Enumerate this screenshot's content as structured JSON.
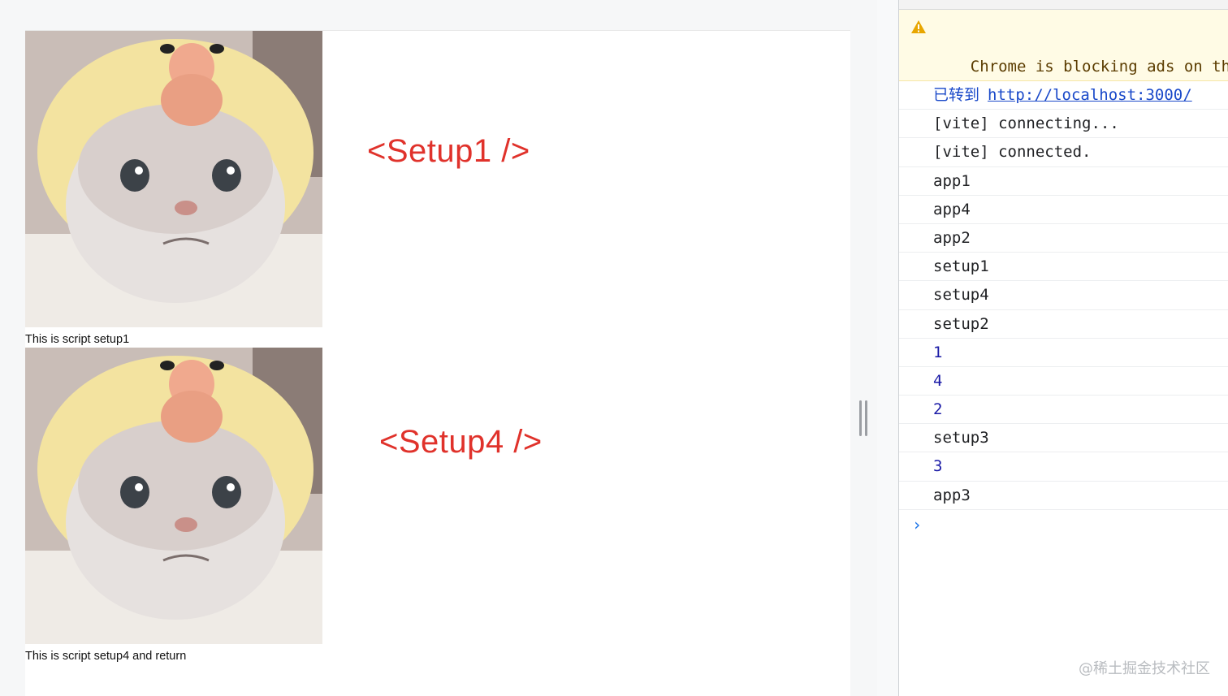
{
  "page": {
    "cards": [
      {
        "caption": "This is script setup1",
        "image_alt": "cat wearing yellow chick hat"
      },
      {
        "caption": "This is script setup4 and return",
        "image_alt": "cat wearing yellow chick hat"
      }
    ],
    "annotations": [
      "<Setup1 />",
      "<Setup4 />"
    ],
    "annotation_color": "#e0322b"
  },
  "console": {
    "warning": "Chrome is blocking ads on thi\ndistract, mislead, or prevent\nyour site for another review.",
    "redirect_label": "已转到",
    "redirect_url": "http://localhost:3000/",
    "messages": [
      {
        "text": "[vite] connecting...",
        "type": "log"
      },
      {
        "text": "[vite] connected.",
        "type": "log"
      },
      {
        "text": "app1",
        "type": "log"
      },
      {
        "text": "app4",
        "type": "log"
      },
      {
        "text": "app2",
        "type": "log"
      },
      {
        "text": "setup1",
        "type": "log"
      },
      {
        "text": "setup4",
        "type": "log"
      },
      {
        "text": "setup2",
        "type": "log"
      },
      {
        "text": "1",
        "type": "number"
      },
      {
        "text": "4",
        "type": "number"
      },
      {
        "text": "2",
        "type": "number"
      },
      {
        "text": "setup3",
        "type": "log"
      },
      {
        "text": "3",
        "type": "number"
      },
      {
        "text": "app3",
        "type": "log"
      }
    ],
    "prompt_symbol": "›"
  },
  "watermark": "@稀土掘金技术社区"
}
